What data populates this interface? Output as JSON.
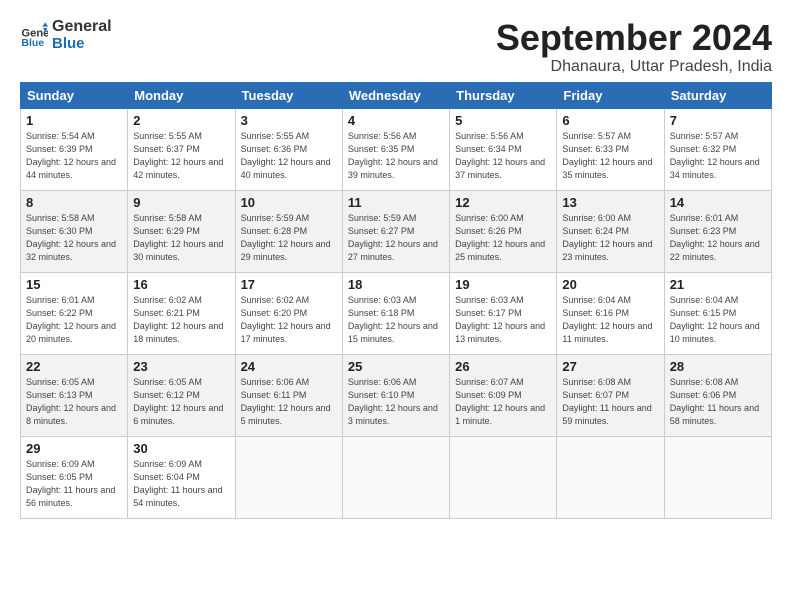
{
  "header": {
    "logo_line1": "General",
    "logo_line2": "Blue",
    "month_year": "September 2024",
    "location": "Dhanaura, Uttar Pradesh, India"
  },
  "weekdays": [
    "Sunday",
    "Monday",
    "Tuesday",
    "Wednesday",
    "Thursday",
    "Friday",
    "Saturday"
  ],
  "weeks": [
    [
      {
        "day": "1",
        "sunrise": "Sunrise: 5:54 AM",
        "sunset": "Sunset: 6:39 PM",
        "daylight": "Daylight: 12 hours and 44 minutes."
      },
      {
        "day": "2",
        "sunrise": "Sunrise: 5:55 AM",
        "sunset": "Sunset: 6:37 PM",
        "daylight": "Daylight: 12 hours and 42 minutes."
      },
      {
        "day": "3",
        "sunrise": "Sunrise: 5:55 AM",
        "sunset": "Sunset: 6:36 PM",
        "daylight": "Daylight: 12 hours and 40 minutes."
      },
      {
        "day": "4",
        "sunrise": "Sunrise: 5:56 AM",
        "sunset": "Sunset: 6:35 PM",
        "daylight": "Daylight: 12 hours and 39 minutes."
      },
      {
        "day": "5",
        "sunrise": "Sunrise: 5:56 AM",
        "sunset": "Sunset: 6:34 PM",
        "daylight": "Daylight: 12 hours and 37 minutes."
      },
      {
        "day": "6",
        "sunrise": "Sunrise: 5:57 AM",
        "sunset": "Sunset: 6:33 PM",
        "daylight": "Daylight: 12 hours and 35 minutes."
      },
      {
        "day": "7",
        "sunrise": "Sunrise: 5:57 AM",
        "sunset": "Sunset: 6:32 PM",
        "daylight": "Daylight: 12 hours and 34 minutes."
      }
    ],
    [
      {
        "day": "8",
        "sunrise": "Sunrise: 5:58 AM",
        "sunset": "Sunset: 6:30 PM",
        "daylight": "Daylight: 12 hours and 32 minutes."
      },
      {
        "day": "9",
        "sunrise": "Sunrise: 5:58 AM",
        "sunset": "Sunset: 6:29 PM",
        "daylight": "Daylight: 12 hours and 30 minutes."
      },
      {
        "day": "10",
        "sunrise": "Sunrise: 5:59 AM",
        "sunset": "Sunset: 6:28 PM",
        "daylight": "Daylight: 12 hours and 29 minutes."
      },
      {
        "day": "11",
        "sunrise": "Sunrise: 5:59 AM",
        "sunset": "Sunset: 6:27 PM",
        "daylight": "Daylight: 12 hours and 27 minutes."
      },
      {
        "day": "12",
        "sunrise": "Sunrise: 6:00 AM",
        "sunset": "Sunset: 6:26 PM",
        "daylight": "Daylight: 12 hours and 25 minutes."
      },
      {
        "day": "13",
        "sunrise": "Sunrise: 6:00 AM",
        "sunset": "Sunset: 6:24 PM",
        "daylight": "Daylight: 12 hours and 23 minutes."
      },
      {
        "day": "14",
        "sunrise": "Sunrise: 6:01 AM",
        "sunset": "Sunset: 6:23 PM",
        "daylight": "Daylight: 12 hours and 22 minutes."
      }
    ],
    [
      {
        "day": "15",
        "sunrise": "Sunrise: 6:01 AM",
        "sunset": "Sunset: 6:22 PM",
        "daylight": "Daylight: 12 hours and 20 minutes."
      },
      {
        "day": "16",
        "sunrise": "Sunrise: 6:02 AM",
        "sunset": "Sunset: 6:21 PM",
        "daylight": "Daylight: 12 hours and 18 minutes."
      },
      {
        "day": "17",
        "sunrise": "Sunrise: 6:02 AM",
        "sunset": "Sunset: 6:20 PM",
        "daylight": "Daylight: 12 hours and 17 minutes."
      },
      {
        "day": "18",
        "sunrise": "Sunrise: 6:03 AM",
        "sunset": "Sunset: 6:18 PM",
        "daylight": "Daylight: 12 hours and 15 minutes."
      },
      {
        "day": "19",
        "sunrise": "Sunrise: 6:03 AM",
        "sunset": "Sunset: 6:17 PM",
        "daylight": "Daylight: 12 hours and 13 minutes."
      },
      {
        "day": "20",
        "sunrise": "Sunrise: 6:04 AM",
        "sunset": "Sunset: 6:16 PM",
        "daylight": "Daylight: 12 hours and 11 minutes."
      },
      {
        "day": "21",
        "sunrise": "Sunrise: 6:04 AM",
        "sunset": "Sunset: 6:15 PM",
        "daylight": "Daylight: 12 hours and 10 minutes."
      }
    ],
    [
      {
        "day": "22",
        "sunrise": "Sunrise: 6:05 AM",
        "sunset": "Sunset: 6:13 PM",
        "daylight": "Daylight: 12 hours and 8 minutes."
      },
      {
        "day": "23",
        "sunrise": "Sunrise: 6:05 AM",
        "sunset": "Sunset: 6:12 PM",
        "daylight": "Daylight: 12 hours and 6 minutes."
      },
      {
        "day": "24",
        "sunrise": "Sunrise: 6:06 AM",
        "sunset": "Sunset: 6:11 PM",
        "daylight": "Daylight: 12 hours and 5 minutes."
      },
      {
        "day": "25",
        "sunrise": "Sunrise: 6:06 AM",
        "sunset": "Sunset: 6:10 PM",
        "daylight": "Daylight: 12 hours and 3 minutes."
      },
      {
        "day": "26",
        "sunrise": "Sunrise: 6:07 AM",
        "sunset": "Sunset: 6:09 PM",
        "daylight": "Daylight: 12 hours and 1 minute."
      },
      {
        "day": "27",
        "sunrise": "Sunrise: 6:08 AM",
        "sunset": "Sunset: 6:07 PM",
        "daylight": "Daylight: 11 hours and 59 minutes."
      },
      {
        "day": "28",
        "sunrise": "Sunrise: 6:08 AM",
        "sunset": "Sunset: 6:06 PM",
        "daylight": "Daylight: 11 hours and 58 minutes."
      }
    ],
    [
      {
        "day": "29",
        "sunrise": "Sunrise: 6:09 AM",
        "sunset": "Sunset: 6:05 PM",
        "daylight": "Daylight: 11 hours and 56 minutes."
      },
      {
        "day": "30",
        "sunrise": "Sunrise: 6:09 AM",
        "sunset": "Sunset: 6:04 PM",
        "daylight": "Daylight: 11 hours and 54 minutes."
      },
      null,
      null,
      null,
      null,
      null
    ]
  ]
}
